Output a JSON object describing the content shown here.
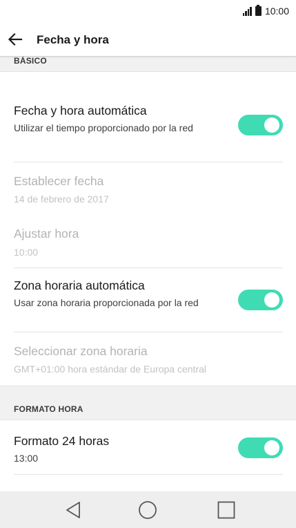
{
  "status_bar": {
    "time": "10:00",
    "icons": [
      "signal-icon",
      "battery-icon"
    ]
  },
  "app_bar": {
    "back_icon": "arrow-left-icon",
    "title": "Fecha y hora"
  },
  "sections": {
    "basic": {
      "header": "BÁSICO",
      "items": {
        "auto_datetime": {
          "title": "Fecha y hora automática",
          "summary": "Utilizar el tiempo proporcionado por la red",
          "enabled": true,
          "toggle_on": true
        },
        "set_date": {
          "title": "Establecer fecha",
          "summary": "14 de febrero de 2017",
          "enabled": false
        },
        "set_time": {
          "title": "Ajustar hora",
          "summary": "10:00",
          "enabled": false
        },
        "auto_timezone": {
          "title": "Zona horaria automática",
          "summary": "Usar zona horaria proporcionada por la red",
          "enabled": true,
          "toggle_on": true
        },
        "select_timezone": {
          "title": "Seleccionar zona horaria",
          "summary": "GMT+01:00 hora estándar de Europa central",
          "enabled": false
        }
      }
    },
    "time_format": {
      "header": "FORMATO HORA",
      "items": {
        "format_24h": {
          "title": "Formato 24 horas",
          "summary": "13:00",
          "enabled": true,
          "toggle_on": true
        }
      }
    }
  },
  "colors": {
    "toggle_on": "#3fdcb4",
    "section_bg": "#f1f1f1",
    "disabled_text": "#b3b3b3",
    "nav_bar_bg": "#eeeeee"
  },
  "nav_bar": {
    "icons": [
      "back-triangle-icon",
      "home-circle-icon",
      "recents-square-icon"
    ]
  }
}
